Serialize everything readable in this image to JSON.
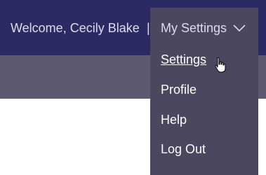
{
  "header": {
    "welcome_text": "Welcome, Cecily Blake",
    "separator": "|"
  },
  "settings_menu": {
    "trigger_label": "My Settings",
    "items": [
      {
        "label": "Settings",
        "hovered": true
      },
      {
        "label": "Profile"
      },
      {
        "label": "Help"
      },
      {
        "label": "Log Out"
      }
    ]
  },
  "colors": {
    "top_bar": "#2b2b63",
    "sub_bar": "#5c5970",
    "menu_bg": "#4a475e",
    "text": "#ffffff"
  },
  "icons": {
    "trigger_chevron": "chevron-down-icon",
    "pointer": "hand-cursor-icon"
  }
}
